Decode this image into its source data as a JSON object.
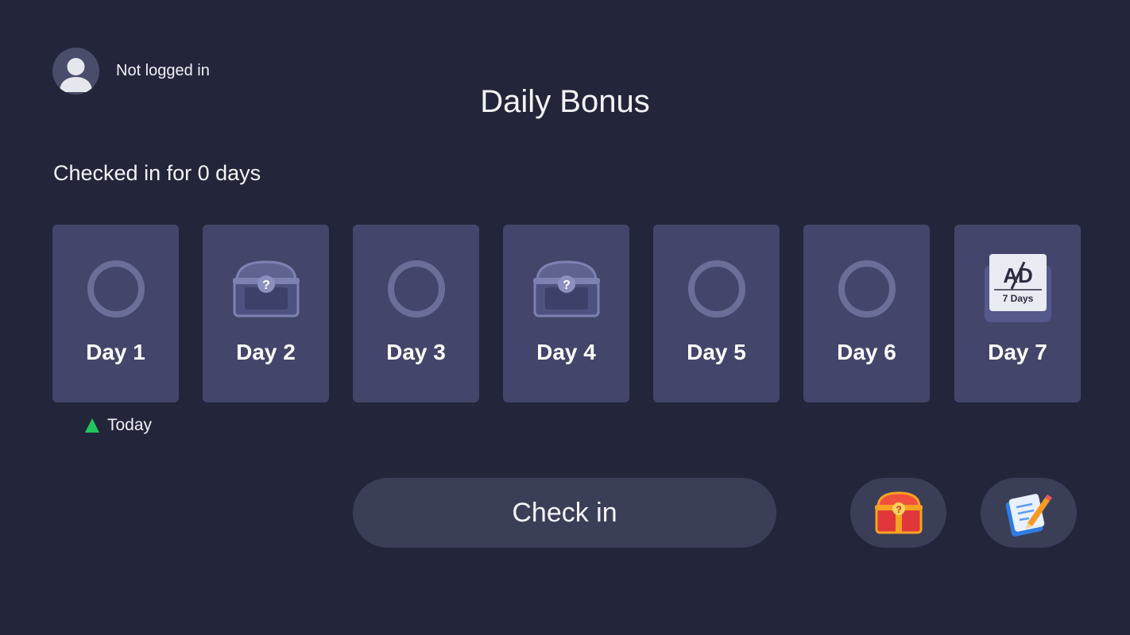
{
  "user": {
    "status": "Not logged in",
    "avatar_icon": "user-avatar-icon"
  },
  "title": "Daily Bonus",
  "streak_text": "Checked in for 0 days",
  "days": [
    {
      "label": "Day 1",
      "icon": "circle-icon"
    },
    {
      "label": "Day 2",
      "icon": "mystery-chest-icon"
    },
    {
      "label": "Day 3",
      "icon": "circle-icon"
    },
    {
      "label": "Day 4",
      "icon": "mystery-chest-icon"
    },
    {
      "label": "Day 5",
      "icon": "circle-icon"
    },
    {
      "label": "Day 6",
      "icon": "circle-icon"
    },
    {
      "label": "Day 7",
      "icon": "ad-free-7-days-icon",
      "badge_top": "AD",
      "badge_bottom": "7 Days"
    }
  ],
  "today_marker": {
    "label": "Today",
    "day_index": 1,
    "color": "#22c55e"
  },
  "actions": {
    "checkin_label": "Check in",
    "gift_icon": "red-mystery-chest-icon",
    "tasks_icon": "notepad-pencil-icon"
  },
  "colors": {
    "background": "#23263a",
    "card": "#43466a",
    "button": "#3b3e57"
  }
}
